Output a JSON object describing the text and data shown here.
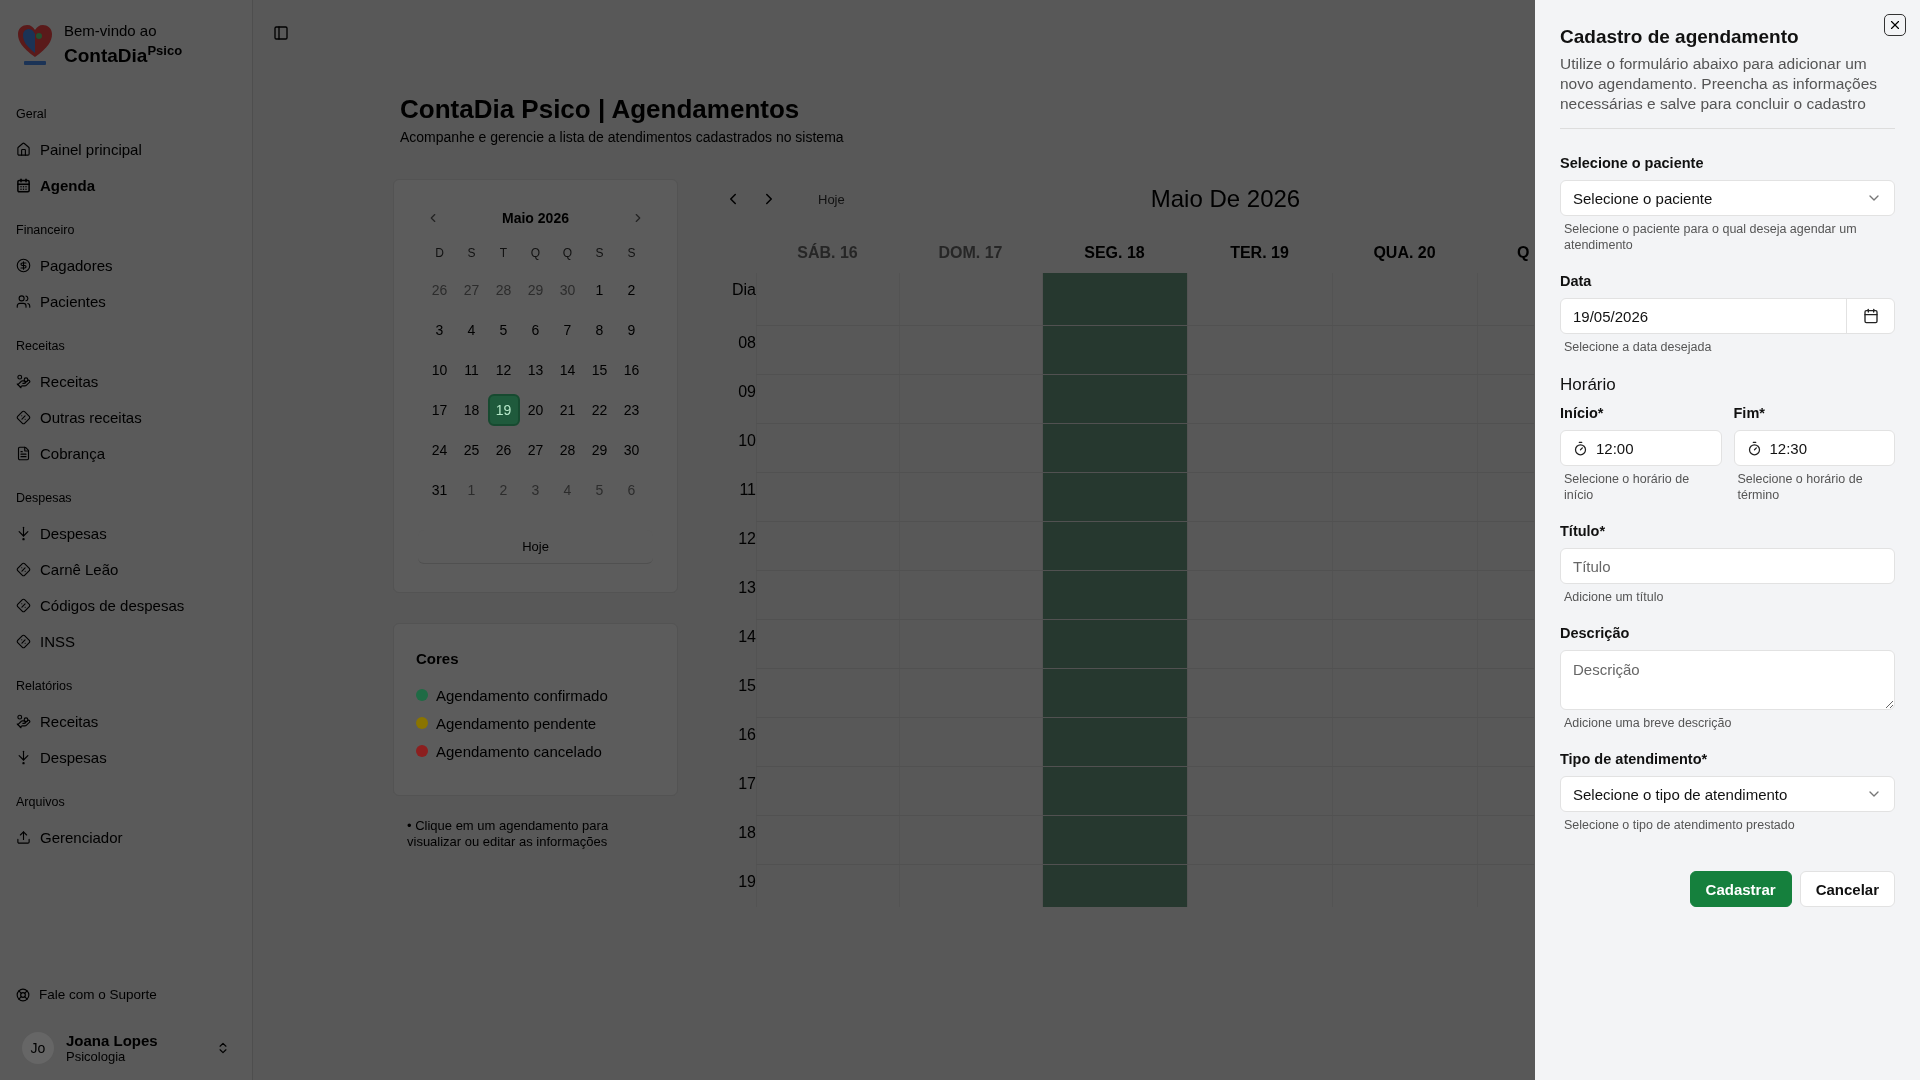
{
  "sidebar": {
    "welcome": "Bem-vindo ao",
    "brand": "ContaDia",
    "brand_sup": "Psico",
    "sections": [
      {
        "title": "Geral",
        "items": [
          {
            "label": "Painel principal",
            "selected": false
          },
          {
            "label": "Agenda",
            "selected": true
          }
        ]
      },
      {
        "title": "Financeiro",
        "items": [
          {
            "label": "Pagadores",
            "selected": false
          },
          {
            "label": "Pacientes",
            "selected": false
          }
        ]
      },
      {
        "title": "Receitas",
        "items": [
          {
            "label": "Receitas",
            "selected": false
          },
          {
            "label": "Outras receitas",
            "selected": false
          },
          {
            "label": "Cobrança",
            "selected": false
          }
        ]
      },
      {
        "title": "Despesas",
        "items": [
          {
            "label": "Despesas",
            "selected": false
          },
          {
            "label": "Carnê Leão",
            "selected": false
          },
          {
            "label": "Códigos de despesas",
            "selected": false
          },
          {
            "label": "INSS",
            "selected": false
          }
        ]
      },
      {
        "title": "Relatórios",
        "items": [
          {
            "label": "Receitas",
            "selected": false
          },
          {
            "label": "Despesas",
            "selected": false
          }
        ]
      },
      {
        "title": "Arquivos",
        "items": [
          {
            "label": "Gerenciador",
            "selected": false
          }
        ]
      }
    ],
    "support": "Fale com o Suporte",
    "user": {
      "initials": "Jo",
      "name": "Joana Lopes",
      "role": "Psicologia"
    }
  },
  "header": {
    "title": "ContaDia Psico | Agendamentos",
    "subtitle": "Acompanhe e gerencie a lista de atendimentos cadastrados no sistema"
  },
  "mini_calendar": {
    "month": "Maio 2026",
    "weekdays": [
      "D",
      "S",
      "T",
      "Q",
      "Q",
      "S",
      "S"
    ],
    "weeks": [
      [
        {
          "day": "26",
          "outside": true,
          "selected": false
        },
        {
          "day": "27",
          "outside": true,
          "selected": false
        },
        {
          "day": "28",
          "outside": true,
          "selected": false
        },
        {
          "day": "29",
          "outside": true,
          "selected": false
        },
        {
          "day": "30",
          "outside": true,
          "selected": false
        },
        {
          "day": "1",
          "outside": false,
          "selected": false
        },
        {
          "day": "2",
          "outside": false,
          "selected": false
        }
      ],
      [
        {
          "day": "3",
          "outside": false,
          "selected": false
        },
        {
          "day": "4",
          "outside": false,
          "selected": false
        },
        {
          "day": "5",
          "outside": false,
          "selected": false
        },
        {
          "day": "6",
          "outside": false,
          "selected": false
        },
        {
          "day": "7",
          "outside": false,
          "selected": false
        },
        {
          "day": "8",
          "outside": false,
          "selected": false
        },
        {
          "day": "9",
          "outside": false,
          "selected": false
        }
      ],
      [
        {
          "day": "10",
          "outside": false,
          "selected": false
        },
        {
          "day": "11",
          "outside": false,
          "selected": false
        },
        {
          "day": "12",
          "outside": false,
          "selected": false
        },
        {
          "day": "13",
          "outside": false,
          "selected": false
        },
        {
          "day": "14",
          "outside": false,
          "selected": false
        },
        {
          "day": "15",
          "outside": false,
          "selected": false
        },
        {
          "day": "16",
          "outside": false,
          "selected": false
        }
      ],
      [
        {
          "day": "17",
          "outside": false,
          "selected": false
        },
        {
          "day": "18",
          "outside": false,
          "selected": false
        },
        {
          "day": "19",
          "outside": false,
          "selected": true
        },
        {
          "day": "20",
          "outside": false,
          "selected": false
        },
        {
          "day": "21",
          "outside": false,
          "selected": false
        },
        {
          "day": "22",
          "outside": false,
          "selected": false
        },
        {
          "day": "23",
          "outside": false,
          "selected": false
        }
      ],
      [
        {
          "day": "24",
          "outside": false,
          "selected": false
        },
        {
          "day": "25",
          "outside": false,
          "selected": false
        },
        {
          "day": "26",
          "outside": false,
          "selected": false
        },
        {
          "day": "27",
          "outside": false,
          "selected": false
        },
        {
          "day": "28",
          "outside": false,
          "selected": false
        },
        {
          "day": "29",
          "outside": false,
          "selected": false
        },
        {
          "day": "30",
          "outside": false,
          "selected": false
        }
      ],
      [
        {
          "day": "31",
          "outside": false,
          "selected": false
        },
        {
          "day": "1",
          "outside": true,
          "selected": false
        },
        {
          "day": "2",
          "outside": true,
          "selected": false
        },
        {
          "day": "3",
          "outside": true,
          "selected": false
        },
        {
          "day": "4",
          "outside": true,
          "selected": false
        },
        {
          "day": "5",
          "outside": true,
          "selected": false
        },
        {
          "day": "6",
          "outside": true,
          "selected": false
        }
      ]
    ],
    "today_button": "Hoje"
  },
  "legend": {
    "title": "Cores",
    "items": [
      {
        "label": "Agendamento confirmado",
        "color": "#1f6b45"
      },
      {
        "label": "Agendamento pendente",
        "color": "#8a7400"
      },
      {
        "label": "Agendamento cancelado",
        "color": "#8c1f1f"
      }
    ]
  },
  "hint": "• Clique em um agendamento para visualizar ou editar as informações",
  "week_calendar": {
    "today_button": "Hoje",
    "title": "Maio De 2026",
    "days": [
      {
        "label": "SÁB. 16",
        "muted": true,
        "selected": false
      },
      {
        "label": "DOM. 17",
        "muted": true,
        "selected": false
      },
      {
        "label": "SEG. 18",
        "muted": false,
        "selected": true
      },
      {
        "label": "TER. 19",
        "muted": false,
        "selected": false
      },
      {
        "label": "QUA. 20",
        "muted": false,
        "selected": false
      },
      {
        "label": "Q",
        "muted": false,
        "selected": false
      }
    ],
    "all_day_label": "Dia",
    "hours": [
      "08",
      "09",
      "10",
      "11",
      "12",
      "13",
      "14",
      "15",
      "16",
      "17",
      "18",
      "19"
    ]
  },
  "drawer": {
    "title": "Cadastro de agendamento",
    "description": "Utilize o formulário abaixo para adicionar um novo agendamento. Preencha as informações necessárias e salve para concluir o cadastro",
    "fields": [
      {
        "kind": "select",
        "label": "Selecione o paciente",
        "value": "Selecione o paciente",
        "help": "Selecione o paciente para o qual deseja agendar um atendimento"
      },
      {
        "kind": "date",
        "label": "Data",
        "value": "19/05/2026",
        "help": "Selecione a data desejada"
      },
      {
        "kind": "time_pair",
        "heading": "Horário",
        "fields": [
          {
            "label": "Início*",
            "value": "12:00",
            "help": "Selecione o horário de início"
          },
          {
            "label": "Fim*",
            "value": "12:30",
            "help": "Selecione o horário de término"
          }
        ]
      },
      {
        "kind": "text",
        "label": "Título*",
        "placeholder": "Título",
        "help": "Adicione um título"
      },
      {
        "kind": "textarea",
        "label": "Descrição",
        "placeholder": "Descrição",
        "help": "Adicione uma breve descrição"
      },
      {
        "kind": "select",
        "label": "Tipo de atendimento*",
        "value": "Selecione o tipo de atendimento",
        "help": "Selecione o tipo de atendimento prestado"
      }
    ],
    "buttons": [
      {
        "label": "Cadastrar",
        "kind": "primary"
      },
      {
        "label": "Cancelar",
        "kind": "secondary"
      }
    ]
  }
}
